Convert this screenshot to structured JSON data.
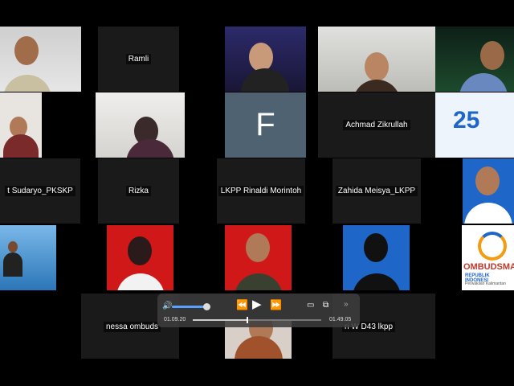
{
  "participants": {
    "ramli": "Ramli",
    "achmad": "Achmad Zikrullah",
    "sudaryo": "t Sudaryo_PKSKP",
    "rizka": "Rizka",
    "rinaldi": "LKPP Rinaldi Morintoh",
    "zahida": "Zahida Meisya_LKPP",
    "nessa": "nessa ombuds",
    "tri": "ri W D43 lkpp",
    "f_initial": "F"
  },
  "logos": {
    "anniv_number": "25",
    "ombudsman_word": "OMBUDSMA",
    "ombudsman_sub": "REPUBLIK INDONESI",
    "ombudsman_sub2": "Perwakilan Kalimantan"
  },
  "player": {
    "elapsed": "01.09.20",
    "remaining": "01.49.05",
    "volume": 0.9,
    "progress": 0.42
  },
  "colors": {
    "tile_dark": "#1a1a1a",
    "red_bg": "#d01818",
    "blue_bg": "#1e66c8",
    "f_tile": "#4f6272"
  }
}
